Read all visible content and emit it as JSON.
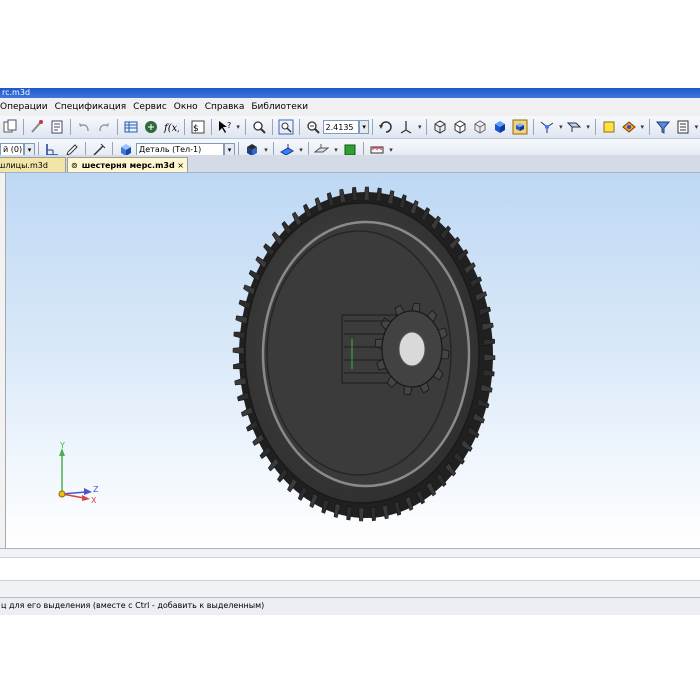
{
  "window": {
    "title": "rc.m3d"
  },
  "menu": {
    "items": [
      {
        "label": "Операции",
        "accel": "О"
      },
      {
        "label": "Спецификация",
        "accel": "С"
      },
      {
        "label": "Сервис",
        "accel": "С"
      },
      {
        "label": "Окно",
        "accel": "О"
      },
      {
        "label": "Справка",
        "accel": "С"
      },
      {
        "label": "Библиотеки",
        "accel": "Б"
      }
    ]
  },
  "toolbar": {
    "zoom_value": "2.4135",
    "layer_value": "й (0)",
    "part_value": "Деталь (Тел-1)"
  },
  "tabs": [
    {
      "label": "шлицы.m3d"
    },
    {
      "label": "шестерня мерс.m3d",
      "close": "×",
      "active": true
    }
  ],
  "axes": {
    "y": "Y",
    "z": "Z",
    "x": "X"
  },
  "status": {
    "text": "ц для его выделения (вместе с Ctrl - добавить к выделенным)"
  },
  "colors": {
    "accent": "#1f57c8",
    "viewport_top": "#bed8f4",
    "gear_body": "#3c3c3c"
  }
}
